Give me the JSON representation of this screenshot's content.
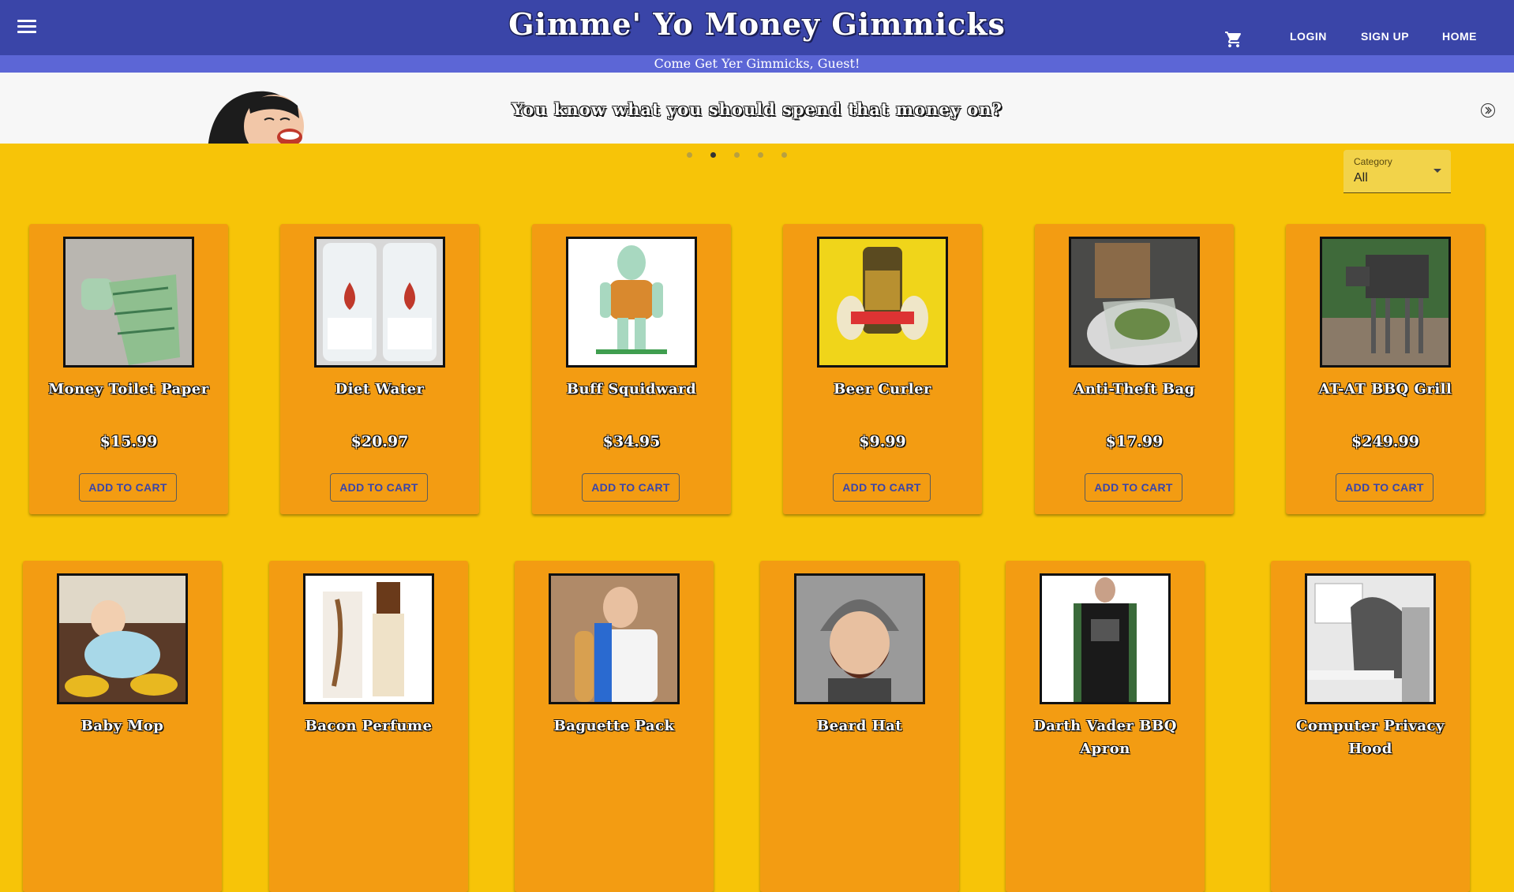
{
  "header": {
    "title": "Gimme' Yo Money Gimmicks",
    "nav": {
      "login": "LOGIN",
      "signup": "SIGN UP",
      "home": "HOME"
    }
  },
  "greeting": "Come Get Yer Gimmicks, Guest!",
  "banner": {
    "text": "You know what you should spend that money on?",
    "active_slide": 2,
    "slide_count": 5
  },
  "filter": {
    "label": "Category",
    "value": "All"
  },
  "add_to_cart_label": "ADD TO CART",
  "products": [
    {
      "name": "Money Toilet Paper",
      "price": "$15.99"
    },
    {
      "name": "Diet Water",
      "price": "$20.97"
    },
    {
      "name": "Buff Squidward",
      "price": "$34.95"
    },
    {
      "name": "Beer Curler",
      "price": "$9.99"
    },
    {
      "name": "Anti-Theft Bag",
      "price": "$17.99"
    },
    {
      "name": "AT-AT BBQ Grill",
      "price": "$249.99"
    },
    {
      "name": "Baby Mop"
    },
    {
      "name": "Bacon Perfume"
    },
    {
      "name": "Baguette Pack"
    },
    {
      "name": "Beard Hat"
    },
    {
      "name": "Darth Vader BBQ Apron"
    },
    {
      "name": "Computer Privacy Hood"
    }
  ],
  "colors": {
    "appbar": "#3a45a8",
    "subbar": "#5c66d6",
    "background": "#f7c408",
    "card": "#f39c12",
    "button_text": "#3a45a8"
  }
}
